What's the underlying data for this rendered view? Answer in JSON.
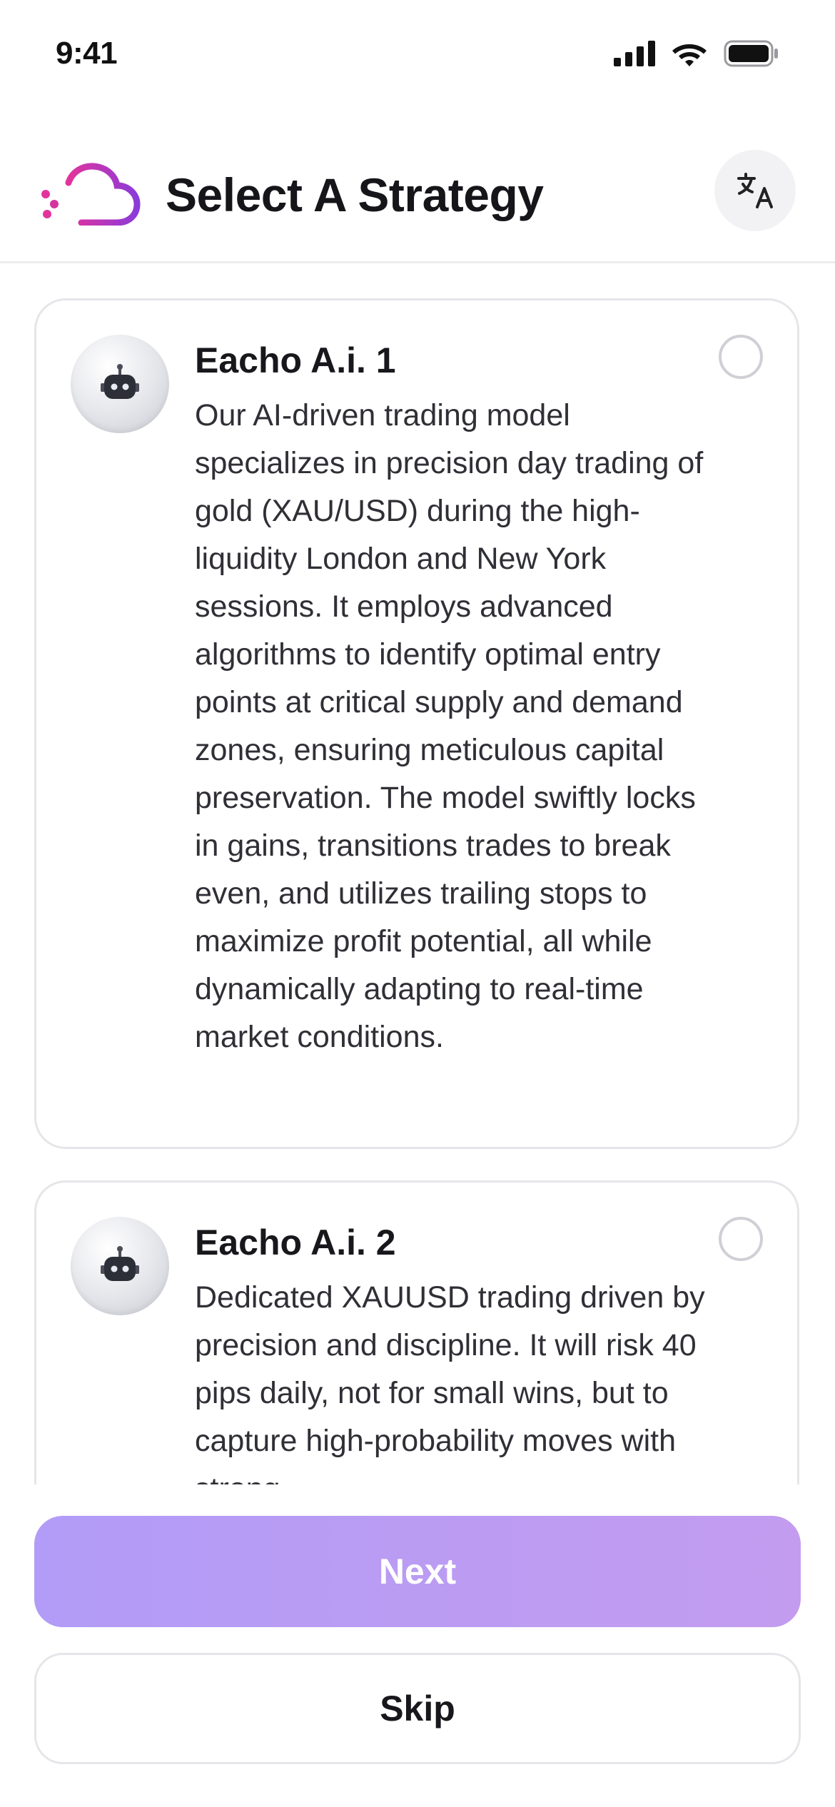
{
  "status_bar": {
    "time": "9:41",
    "icons": [
      "signal-icon",
      "wifi-icon",
      "battery-icon"
    ]
  },
  "header": {
    "title": "Select A Strategy",
    "logo_icon": "cloud-logo-icon",
    "language_icon": "translate-icon"
  },
  "strategies": [
    {
      "name": "Eacho A.i. 1",
      "description": "Our AI-driven trading model specializes in precision day trading of gold (XAU/USD) during the high-liquidity London and New York sessions. It employs advanced algorithms to identify optimal entry points at critical supply and demand zones, ensuring meticulous capital preservation. The model swiftly locks in gains, transitions trades to break even, and utilizes trailing stops to maximize profit potential, all while dynamically adapting to real-time market conditions.",
      "selected": false
    },
    {
      "name": "Eacho A.i. 2",
      "description": "Dedicated XAUUSD trading driven by precision and discipline. It will risk 40 pips daily, not for small wins, but to capture high-probability moves with strong",
      "selected": false
    }
  ],
  "actions": {
    "next_label": "Next",
    "skip_label": "Skip"
  },
  "colors": {
    "accent_gradient_start": "#b29cf7",
    "accent_gradient_end": "#c39cef",
    "logo_magenta": "#c42fd0",
    "logo_purple": "#8b3bd9"
  }
}
